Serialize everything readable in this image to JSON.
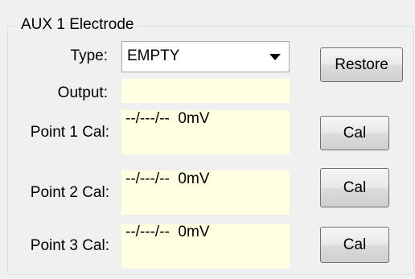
{
  "group": {
    "title": "AUX 1 Electrode"
  },
  "type_row": {
    "label": "Type:",
    "selected": "EMPTY",
    "arrow_icon": "triangle-down"
  },
  "restore_button": {
    "label": "Restore"
  },
  "output_row": {
    "label": "Output:",
    "value": ""
  },
  "calibration_points": [
    {
      "label": "Point 1 Cal:",
      "date": "--/---/--",
      "millivolts": "0mV",
      "button_label": "Cal"
    },
    {
      "label": "Point 2 Cal:",
      "date": "--/---/--",
      "millivolts": "0mV",
      "button_label": "Cal"
    },
    {
      "label": "Point 3 Cal:",
      "date": "--/---/--",
      "millivolts": "0mV",
      "button_label": "Cal"
    }
  ],
  "colors": {
    "readonly_field_bg": "#ffffe1",
    "window_bg": "#f0f0f0",
    "group_border": "#d5dfe5"
  }
}
